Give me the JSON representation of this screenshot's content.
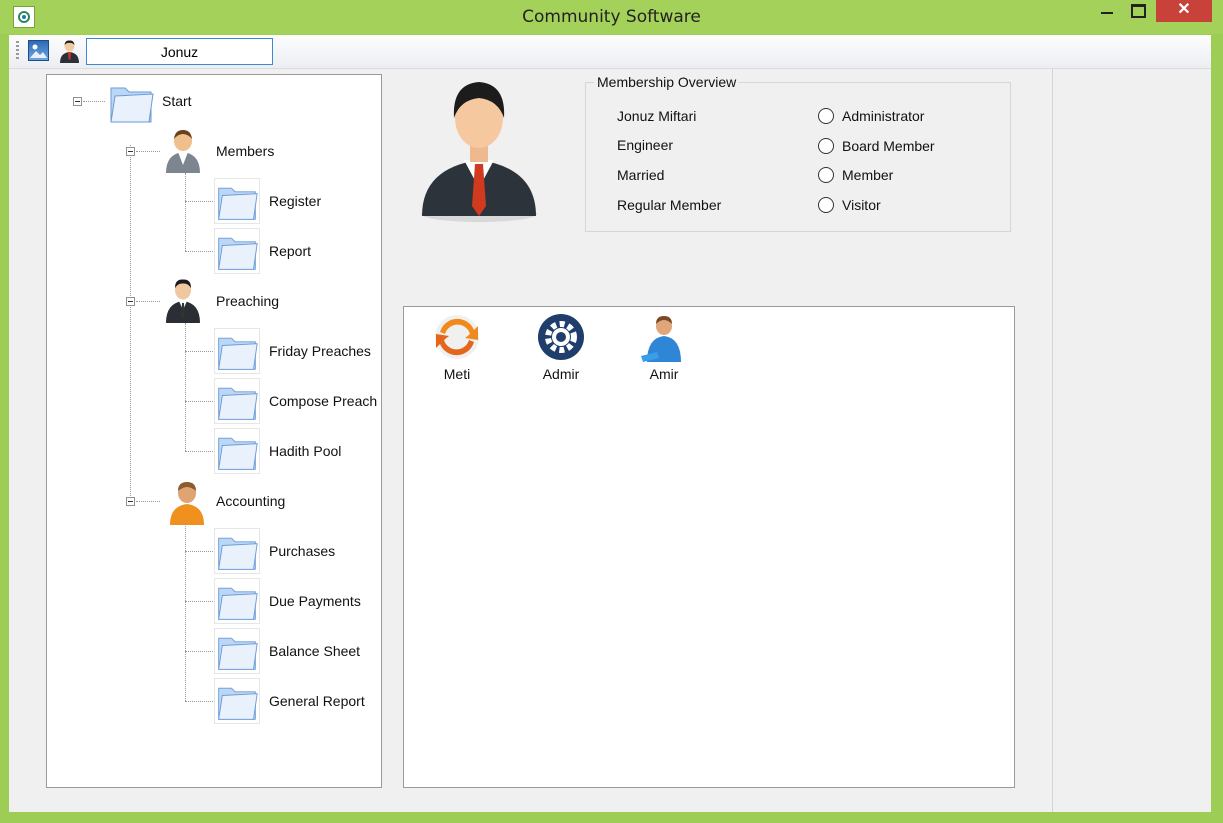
{
  "window": {
    "title": "Community Software",
    "close_glyph": "✕"
  },
  "toolbar": {
    "search_value": "Jonuz"
  },
  "tree": {
    "root": "Start",
    "groups": [
      {
        "label": "Members",
        "icon": "person-icon",
        "children": [
          "Register",
          "Report"
        ]
      },
      {
        "label": "Preaching",
        "icon": "suited-person-icon",
        "children": [
          "Friday Preaches",
          "Compose Preach",
          "Hadith Pool"
        ]
      },
      {
        "label": "Accounting",
        "icon": "person-orange-icon",
        "children": [
          "Purchases",
          "Due Payments",
          "Balance Sheet",
          "General Report"
        ]
      }
    ]
  },
  "overview": {
    "title": "Membership Overview",
    "details": [
      "Jonuz Miftari",
      "Engineer",
      "Married",
      "Regular Member"
    ],
    "roles": [
      "Administrator",
      "Board Member",
      "Member",
      "Visitor"
    ]
  },
  "list": {
    "items": [
      {
        "label": "Meti",
        "icon": "sync-orange-icon"
      },
      {
        "label": "Admir",
        "icon": "gear-icon"
      },
      {
        "label": "Amir",
        "icon": "user-blue-icon"
      }
    ]
  },
  "colors": {
    "frame": "#a3d15a",
    "close": "#c9423a",
    "accent": "#3e86d6"
  }
}
